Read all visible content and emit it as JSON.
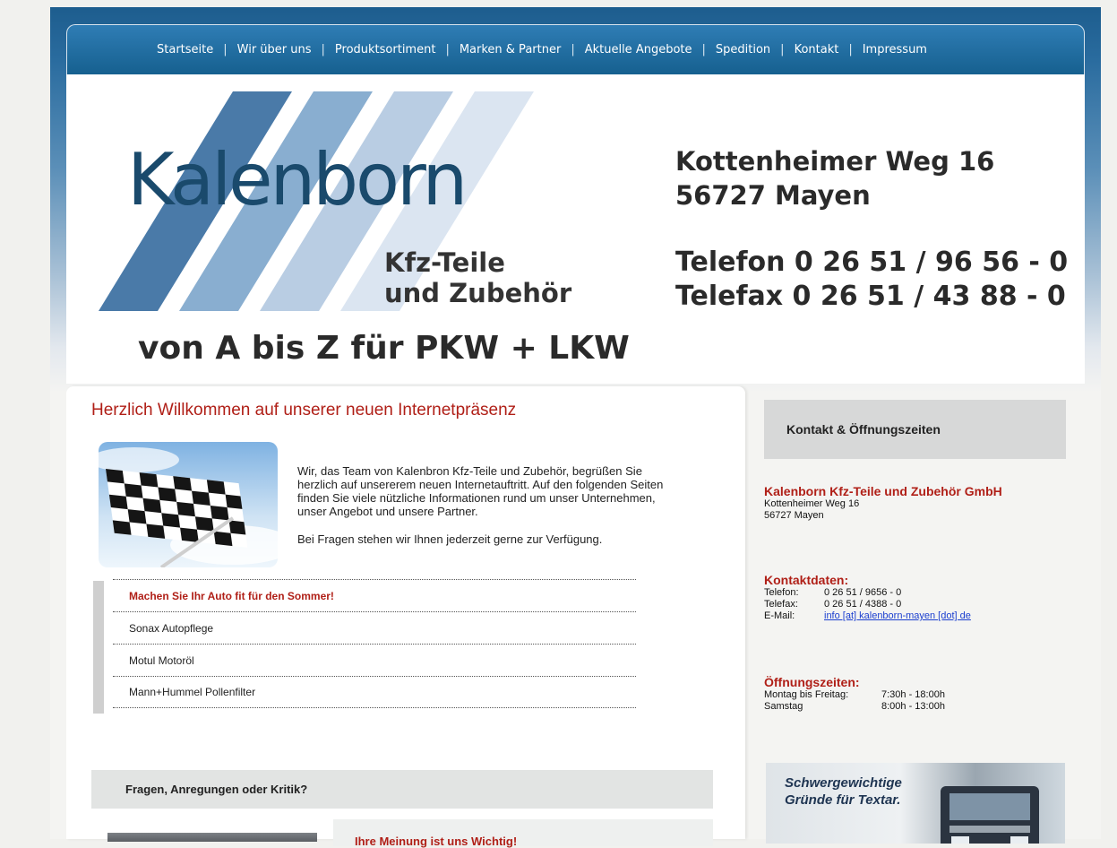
{
  "nav": {
    "items": [
      "Startseite",
      "Wir über uns",
      "Produktsortiment",
      "Marken & Partner",
      "Aktuelle Angebote",
      "Spedition",
      "Kontakt",
      "Impressum"
    ],
    "separator": "|"
  },
  "header": {
    "logo_text": "Kalenborn",
    "logo_sub_1": "Kfz-Teile",
    "logo_sub_2": "und Zubehör",
    "tagline": "von A bis Z für PKW + LKW",
    "address_1": "Kottenheimer Weg 16",
    "address_2": "56727 Mayen",
    "phone": "Telefon 0 26 51 / 96 56 - 0",
    "fax": "Telefax 0 26 51 / 43 88 - 0"
  },
  "main": {
    "welcome_title": "Herzlich Willkommen auf unserer neuen Internetpräsenz",
    "welcome_p1": "Wir, das Team von Kalenbron Kfz-Teile und Zubehör, begrüßen Sie herzlich auf unsererem neuen Internetauftritt. Auf den folgenden Seiten finden Sie viele nützliche Informationen rund um unser Unternehmen, unser Angebot und unsere Partner.",
    "welcome_p2": "Bei Fragen stehen wir Ihnen jederzeit gerne zur Verfügung.",
    "promo_heading": "Machen Sie Ihr Auto fit für den Sommer!",
    "promo_items": [
      "Sonax Autopflege",
      "Motul Motoröl",
      "Mann+Hummel Pollenfilter"
    ],
    "feedback_heading": "Fragen, Anregungen oder Kritik?",
    "opinion_title": "Ihre Meinung ist uns Wichtig!"
  },
  "sidebar": {
    "heading": "Kontakt & Öffnungszeiten",
    "company": "Kalenborn Kfz-Teile und Zubehör GmbH",
    "street": "Kottenheimer Weg 16",
    "city": "56727 Mayen",
    "contact_title": "Kontaktdaten:",
    "phone_label": "Telefon:",
    "phone_value": "0 26 51 / 9656 - 0",
    "fax_label": "Telefax:",
    "fax_value": "0 26 51 / 4388 - 0",
    "email_label": "E-Mail:",
    "email_value": "info [at] kalenborn-mayen [dot] de",
    "hours_title": "Öffnungszeiten:",
    "hours_weekday_label": "Montag bis Freitag:",
    "hours_weekday_value": "7:30h - 18:00h",
    "hours_saturday_label": "Samstag",
    "hours_saturday_value": "8:00h - 13:00h",
    "banner_line1": "Schwergewichtige",
    "banner_line2": "Gründe für Textar."
  },
  "colors": {
    "nav_blue": "#1d6c9f",
    "accent_red": "#b01f17",
    "logo_blue": "#1a4a6c",
    "link_blue": "#1a3ecf"
  }
}
